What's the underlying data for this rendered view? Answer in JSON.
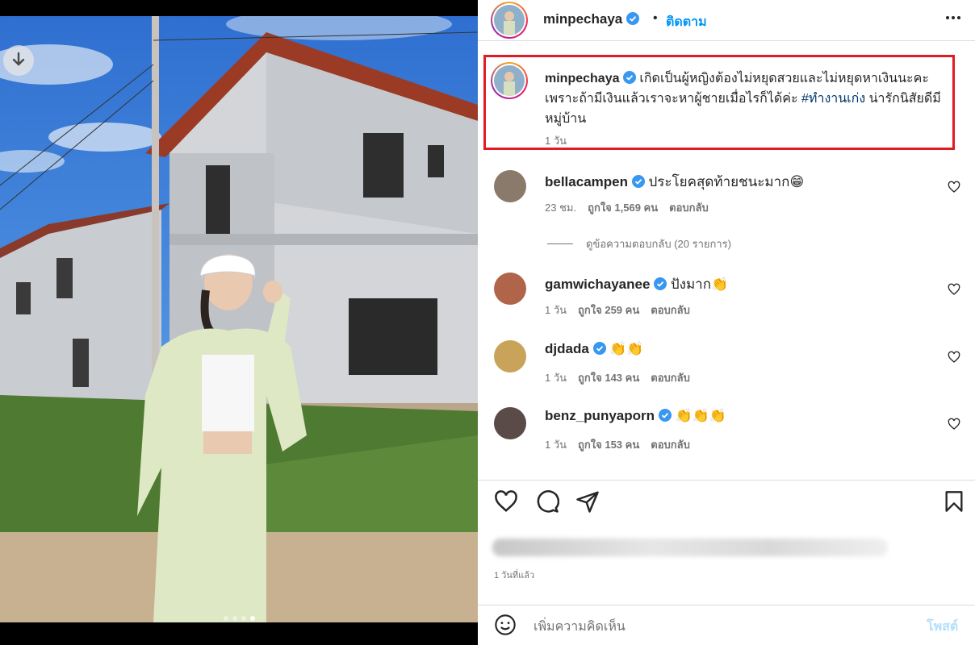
{
  "post": {
    "username": "minpechaya",
    "separator": "•",
    "follow_label": "ติดตาม",
    "more_icon": "more-options-icon",
    "photo_carousel": {
      "total": 4,
      "active_index": 3
    }
  },
  "caption": {
    "username": "minpechaya",
    "text_before": "เกิดเป็นผู้หญิงต้องไม่หยุดสวยและไม่หยุดหาเงินนะคะ เพราะถ้ามีเงินแล้วเราจะหาผู้ชายเมื่อไรก็ได้ค่ะ",
    "hashtag": "#ทำงานเก่ง",
    "text_after": "น่ารักนิสัยดีมีหมู่บ้าน",
    "time": "1 วัน"
  },
  "comments": [
    {
      "username": "bellacampen",
      "text": "ประโยคสุดท้ายชนะมาก😁",
      "time": "23 ชม.",
      "likes": "ถูกใจ 1,569 คน",
      "reply": "ตอบกลับ",
      "avatar_color": "#8a7a6a"
    },
    {
      "username": "gamwichayanee",
      "text": "ปังมาก👏",
      "time": "1 วัน",
      "likes": "ถูกใจ 259 คน",
      "reply": "ตอบกลับ",
      "avatar_color": "#b0654a"
    },
    {
      "username": "djdada",
      "text": "👏👏",
      "time": "1 วัน",
      "likes": "ถูกใจ 143 คน",
      "reply": "ตอบกลับ",
      "avatar_color": "#c9a35a"
    },
    {
      "username": "benz_punyaporn",
      "text": "👏👏👏",
      "time": "1 วัน",
      "likes": "ถูกใจ 153 คน",
      "reply": "ตอบกลับ",
      "avatar_color": "#5a4a48"
    }
  ],
  "view_replies": "ดูข้อความตอบกลับ (20 รายการ)",
  "post_date": "1 วันที่แล้ว",
  "add_comment": {
    "placeholder": "เพิ่มความคิดเห็น",
    "post_label": "โพสต์"
  },
  "colors": {
    "verified": "#3897f0",
    "follow": "#0095f6",
    "highlight_border": "#e01b24"
  }
}
